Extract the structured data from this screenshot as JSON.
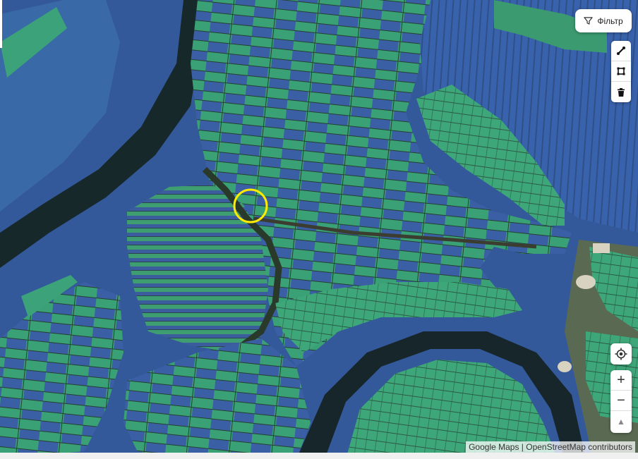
{
  "toolbar": {
    "filter_label": "Фільтр",
    "filter_icon": "funnel-icon",
    "draw_tools": [
      "line-tool-icon",
      "polygon-tool-icon",
      "trash-icon"
    ]
  },
  "map_controls": {
    "locate_icon": "crosshair-icon",
    "zoom_in": "+",
    "zoom_out": "−",
    "compass": "▲"
  },
  "attribution": "Google Maps | OpenStreetMap contributors",
  "colors": {
    "field_green": "#3fbf86",
    "field_blue": "#3758b8",
    "river": "#16262a",
    "marker": "#ffeb00"
  }
}
